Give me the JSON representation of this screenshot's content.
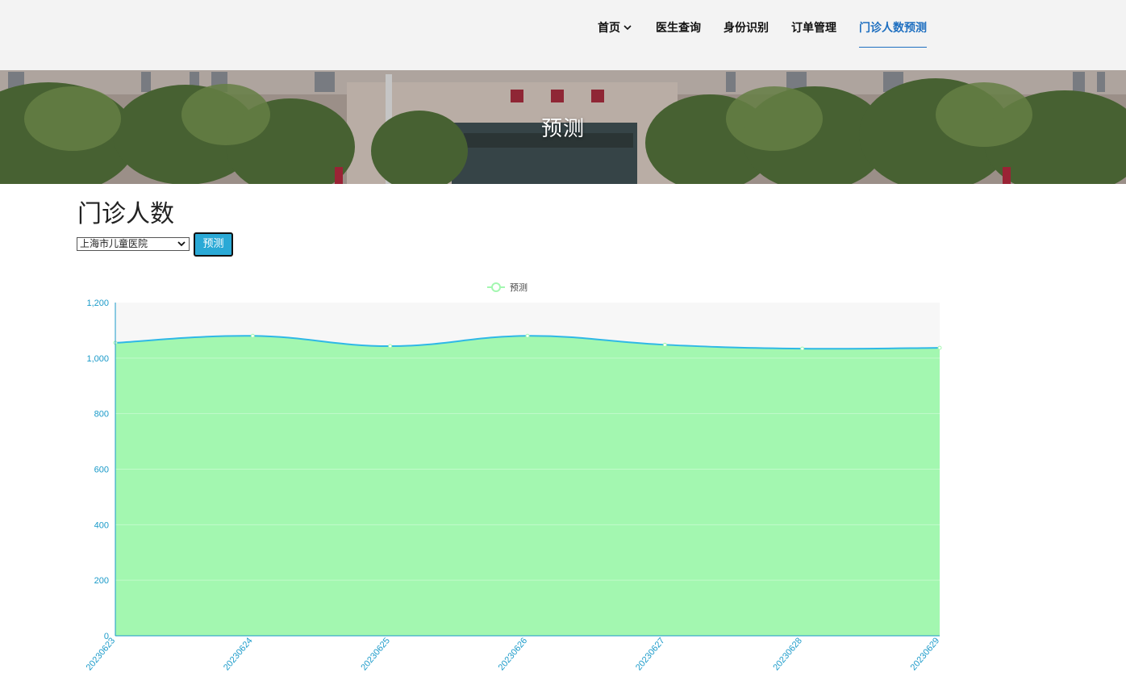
{
  "nav": {
    "items": [
      {
        "label": "首页",
        "dropdown": true
      },
      {
        "label": "医生查询"
      },
      {
        "label": "身份识别"
      },
      {
        "label": "订单管理"
      },
      {
        "label": "门诊人数预测",
        "active": true
      }
    ]
  },
  "hero": {
    "title": "预测"
  },
  "page": {
    "title": "门诊人数"
  },
  "form": {
    "selected_hospital": "上海市儿童医院",
    "button_label": "预测"
  },
  "colors": {
    "accent": "#1e6fc0",
    "axis": "#1a9ac9",
    "area_fill": "#a3f7b0",
    "line": "#2fb8e6"
  },
  "chart_data": {
    "type": "area",
    "legend": [
      "预测"
    ],
    "legend_position": "top-center",
    "x": [
      "20230623",
      "20230624",
      "20230625",
      "20230626",
      "20230627",
      "20230628",
      "20230629"
    ],
    "series": [
      {
        "name": "预测",
        "values": [
          1055,
          1080,
          1043,
          1080,
          1048,
          1034,
          1037
        ]
      }
    ],
    "ylim": [
      0,
      1200
    ],
    "yticks": [
      "0",
      "200",
      "400",
      "600",
      "800",
      "1,000",
      "1,200"
    ],
    "smooth": true,
    "grid": false
  }
}
